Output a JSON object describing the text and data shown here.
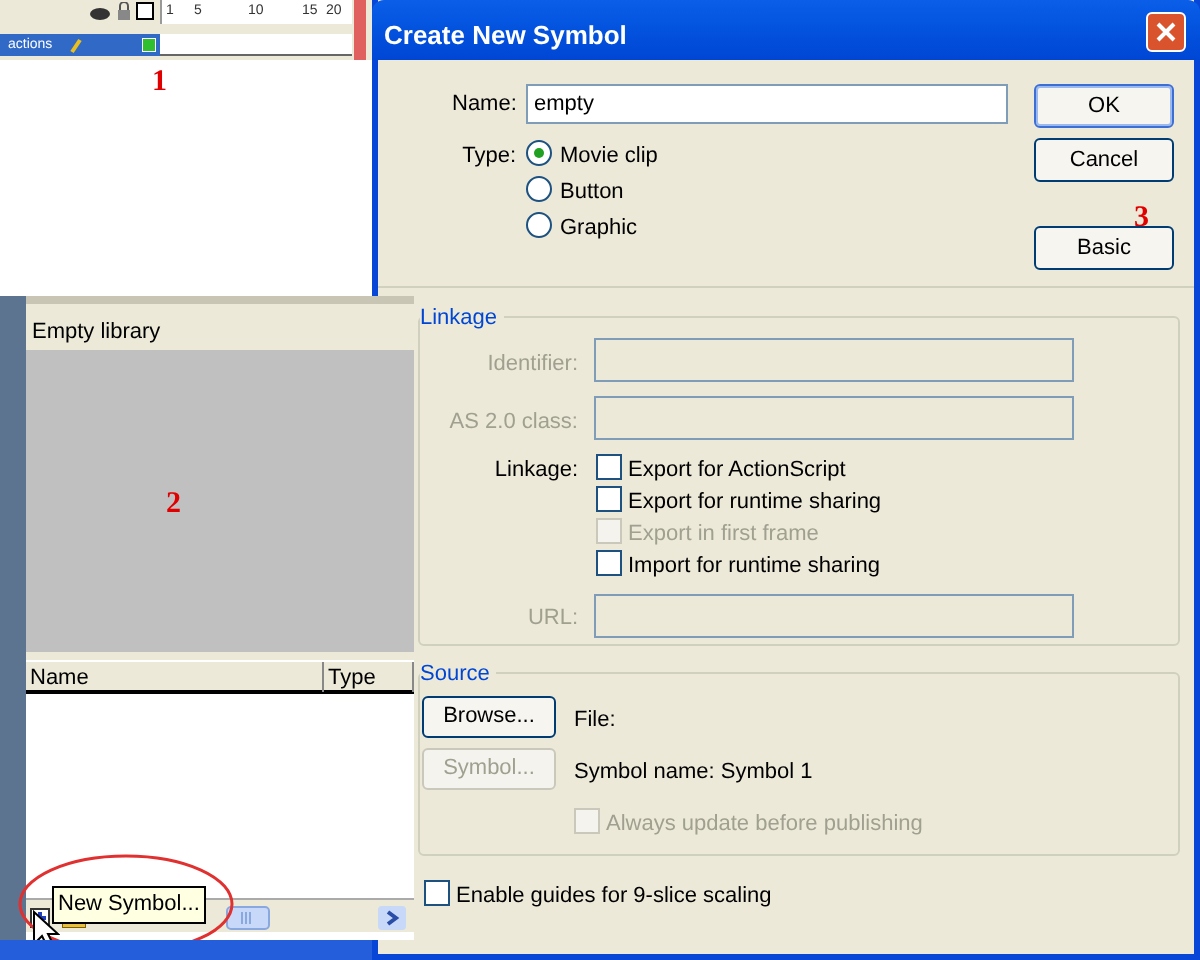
{
  "timeline": {
    "ruler": [
      "1",
      "5",
      "10",
      "15",
      "20"
    ],
    "layer": {
      "name": "actions",
      "selected": true
    }
  },
  "annotations": [
    "1",
    "2",
    "3"
  ],
  "dialog": {
    "title": "Create New Symbol",
    "name_label": "Name:",
    "name_value": "empty",
    "type_label": "Type:",
    "types": [
      {
        "label": "Movie clip",
        "selected": true
      },
      {
        "label": "Button",
        "selected": false
      },
      {
        "label": "Graphic",
        "selected": false
      }
    ],
    "buttons": [
      {
        "label": "OK",
        "default": true
      },
      {
        "label": "Cancel",
        "default": false
      },
      {
        "label": "Basic",
        "default": false
      }
    ],
    "linkage": {
      "title": "Linkage",
      "fields": [
        {
          "label": "Identifier:",
          "disabled": true
        },
        {
          "label": "AS 2.0 class:",
          "disabled": true
        }
      ],
      "checkbox_label": "Linkage:",
      "checkboxes": [
        {
          "label": "Export for ActionScript",
          "checked": false,
          "disabled": false
        },
        {
          "label": "Export for runtime sharing",
          "checked": false,
          "disabled": false
        },
        {
          "label": "Export in first frame",
          "checked": false,
          "disabled": true
        },
        {
          "label": "Import for runtime sharing",
          "checked": false,
          "disabled": false
        }
      ],
      "url": {
        "label": "URL:",
        "disabled": true
      }
    },
    "source": {
      "title": "Source",
      "buttons": [
        {
          "label": "Browse...",
          "disabled": false
        },
        {
          "label": "Symbol...",
          "disabled": true
        }
      ],
      "file_label": "File:",
      "symbol_name": "Symbol name: Symbol 1",
      "always_update": {
        "label": "Always update before publishing",
        "checked": false,
        "disabled": true
      }
    },
    "guides": {
      "label": "Enable guides for 9-slice scaling",
      "checked": false
    }
  },
  "library": {
    "title": "Empty library",
    "columns": [
      "Name",
      "Type"
    ],
    "tooltip": "New Symbol..."
  }
}
